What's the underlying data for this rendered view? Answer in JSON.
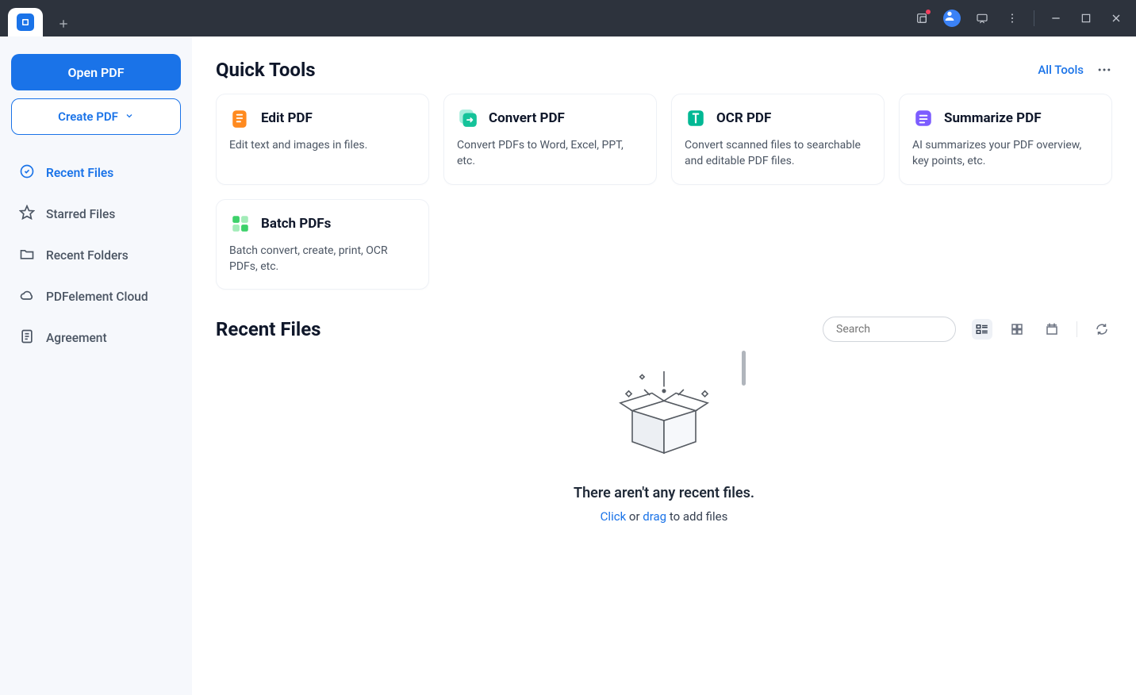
{
  "colors": {
    "primary": "#1a73e8"
  },
  "sidebar": {
    "open_pdf_label": "Open PDF",
    "create_pdf_label": "Create PDF",
    "nav": [
      {
        "label": "Recent Files",
        "icon": "clock-check-icon",
        "active": true
      },
      {
        "label": "Starred Files",
        "icon": "star-icon",
        "active": false
      },
      {
        "label": "Recent Folders",
        "icon": "folder-icon",
        "active": false
      },
      {
        "label": "PDFelement Cloud",
        "icon": "cloud-icon",
        "active": false
      },
      {
        "label": "Agreement",
        "icon": "document-icon",
        "active": false
      }
    ]
  },
  "quick_tools": {
    "heading": "Quick Tools",
    "all_tools_label": "All Tools",
    "cards": [
      {
        "title": "Edit PDF",
        "desc": "Edit text and images in files.",
        "icon_color": "#ff8a1f"
      },
      {
        "title": "Convert PDF",
        "desc": "Convert PDFs to Word, Excel, PPT, etc.",
        "icon_color": "#15c39a"
      },
      {
        "title": "OCR PDF",
        "desc": "Convert scanned files to searchable and editable PDF files.",
        "icon_color": "#00b894"
      },
      {
        "title": "Summarize PDF",
        "desc": "AI summarizes your PDF overview, key points, etc.",
        "icon_color": "#7c5cff"
      },
      {
        "title": "Batch PDFs",
        "desc": "Batch convert, create, print, OCR PDFs, etc.",
        "icon_color": "#3dd16a"
      }
    ]
  },
  "recent_files": {
    "heading": "Recent Files",
    "search_placeholder": "Search",
    "empty_title": "There aren't any recent files.",
    "empty_action_click": "Click",
    "empty_action_or": " or ",
    "empty_action_drag": "drag",
    "empty_action_suffix": " to add files"
  }
}
